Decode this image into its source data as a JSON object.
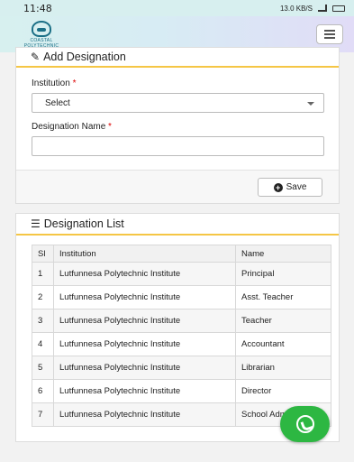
{
  "status_bar": {
    "time": "11:48",
    "speed": "13.0 KB/S"
  },
  "header": {
    "logo_text": "COASTAL POLYTECHNIC",
    "menu_icon": "hamburger-icon"
  },
  "add_form": {
    "title": "Add Designation",
    "title_icon": "edit-icon",
    "institution_label": "Institution",
    "required_mark": "*",
    "institution_selected": "Select",
    "designation_label": "Designation Name",
    "designation_value": "",
    "save_label": "Save"
  },
  "list": {
    "title": "Designation List",
    "title_icon": "list-icon",
    "columns": [
      "Sl",
      "Institution",
      "Name"
    ],
    "rows": [
      [
        "1",
        "Lutfunnesa Polytechnic Institute",
        "Principal"
      ],
      [
        "2",
        "Lutfunnesa Polytechnic Institute",
        "Asst. Teacher"
      ],
      [
        "3",
        "Lutfunnesa Polytechnic Institute",
        "Teacher"
      ],
      [
        "4",
        "Lutfunnesa Polytechnic Institute",
        "Accountant"
      ],
      [
        "5",
        "Lutfunnesa Polytechnic Institute",
        "Librarian"
      ],
      [
        "6",
        "Lutfunnesa Polytechnic Institute",
        "Director"
      ],
      [
        "7",
        "Lutfunnesa Polytechnic Institute",
        "School Admin a"
      ]
    ]
  },
  "whatsapp_icon": "whatsapp-icon",
  "colors": {
    "accent": "#f5c645",
    "whatsapp": "#2db742",
    "required": "#dd0000"
  }
}
